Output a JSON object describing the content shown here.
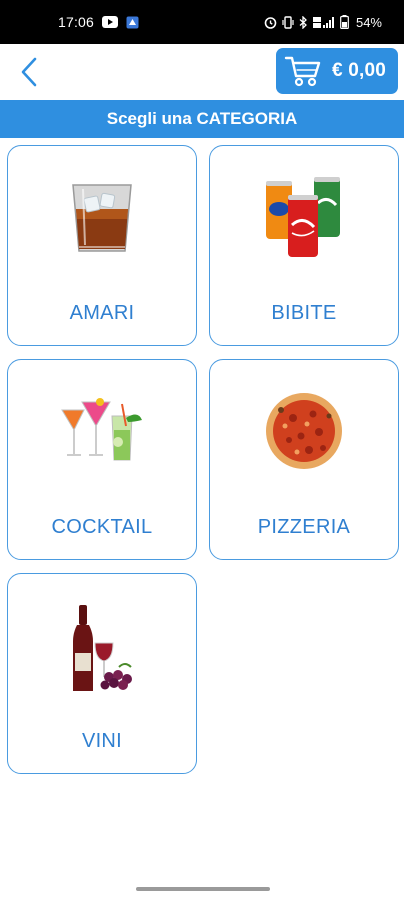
{
  "status_bar": {
    "time": "17:06",
    "battery": "54%",
    "left_icons": [
      "youtube-icon",
      "app-notification-icon"
    ],
    "right_icons": [
      "alarm-icon",
      "vibrate-icon",
      "bluetooth-icon",
      "lte-signal-icon",
      "battery-icon"
    ]
  },
  "header": {
    "cart_total": "€ 0,00",
    "accent_color": "#2f8fe0"
  },
  "title": "Scegli una CATEGORIA",
  "categories": [
    {
      "label": "AMARI",
      "icon": "whiskey-glass-icon"
    },
    {
      "label": "BIBITE",
      "icon": "soda-cans-icon"
    },
    {
      "label": "COCKTAIL",
      "icon": "cocktail-glasses-icon"
    },
    {
      "label": "PIZZERIA",
      "icon": "pizza-icon"
    },
    {
      "label": "VINI",
      "icon": "wine-bottle-icon"
    }
  ]
}
